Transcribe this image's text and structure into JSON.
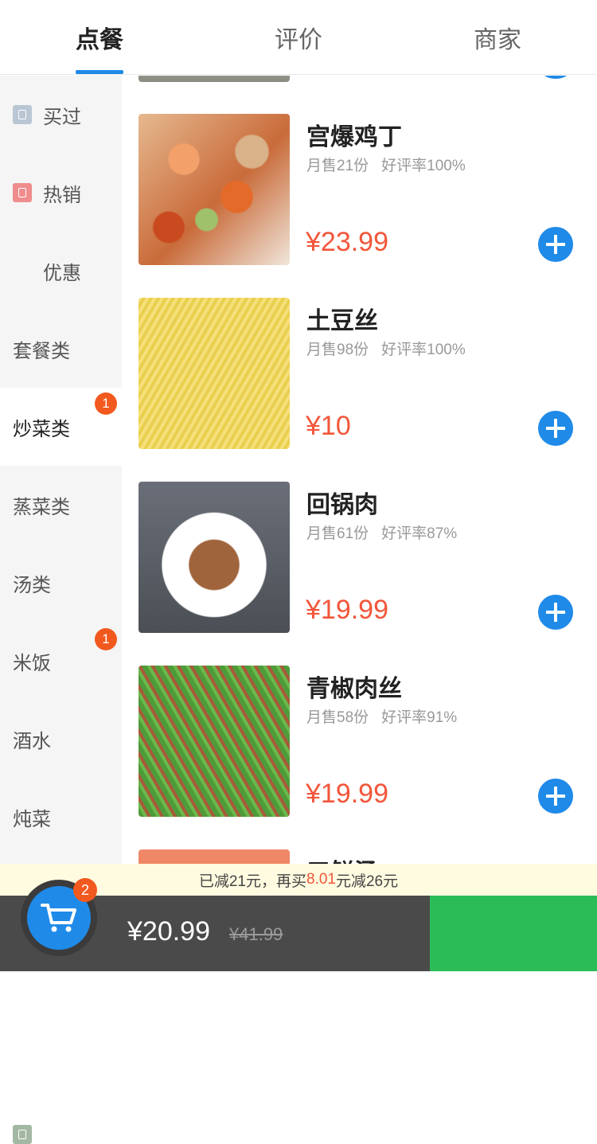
{
  "tabs": [
    {
      "label": "点餐",
      "active": true
    },
    {
      "label": "评价",
      "active": false
    },
    {
      "label": "商家",
      "active": false
    }
  ],
  "sidebar": {
    "items": [
      {
        "label": "买过",
        "icon": "bought-icon"
      },
      {
        "label": "热销",
        "icon": "fire-icon"
      },
      {
        "label": "优惠",
        "icon": "discount-icon"
      },
      {
        "label": "套餐类"
      },
      {
        "label": "炒菜类",
        "active": true,
        "badge": "1"
      },
      {
        "label": "蒸菜类"
      },
      {
        "label": "汤类"
      },
      {
        "label": "米饭",
        "badge": "1"
      },
      {
        "label": "酒水"
      },
      {
        "label": "炖菜"
      }
    ]
  },
  "dishes": [
    {
      "name": "宫爆鸡丁",
      "monthly_sales": "月售21份",
      "rating": "好评率100%",
      "price": "¥23.99"
    },
    {
      "name": "土豆丝",
      "monthly_sales": "月售98份",
      "rating": "好评率100%",
      "price": "¥10"
    },
    {
      "name": "回锅肉",
      "monthly_sales": "月售61份",
      "rating": "好评率87%",
      "price": "¥19.99"
    },
    {
      "name": "青椒肉丝",
      "monthly_sales": "月售58份",
      "rating": "好评率91%",
      "price": "¥19.99"
    },
    {
      "name": "三鲜汤"
    }
  ],
  "promo": {
    "prefix": "已减21元，再买",
    "amount": "8.01",
    "suffix": "元减26元"
  },
  "cart": {
    "count": "2",
    "total": "¥20.99",
    "original_total": "¥41.99"
  },
  "colors": {
    "accent": "#1f8ae8",
    "price": "#f2563a",
    "badge": "#f2591f",
    "checkout": "#2bbc57"
  }
}
